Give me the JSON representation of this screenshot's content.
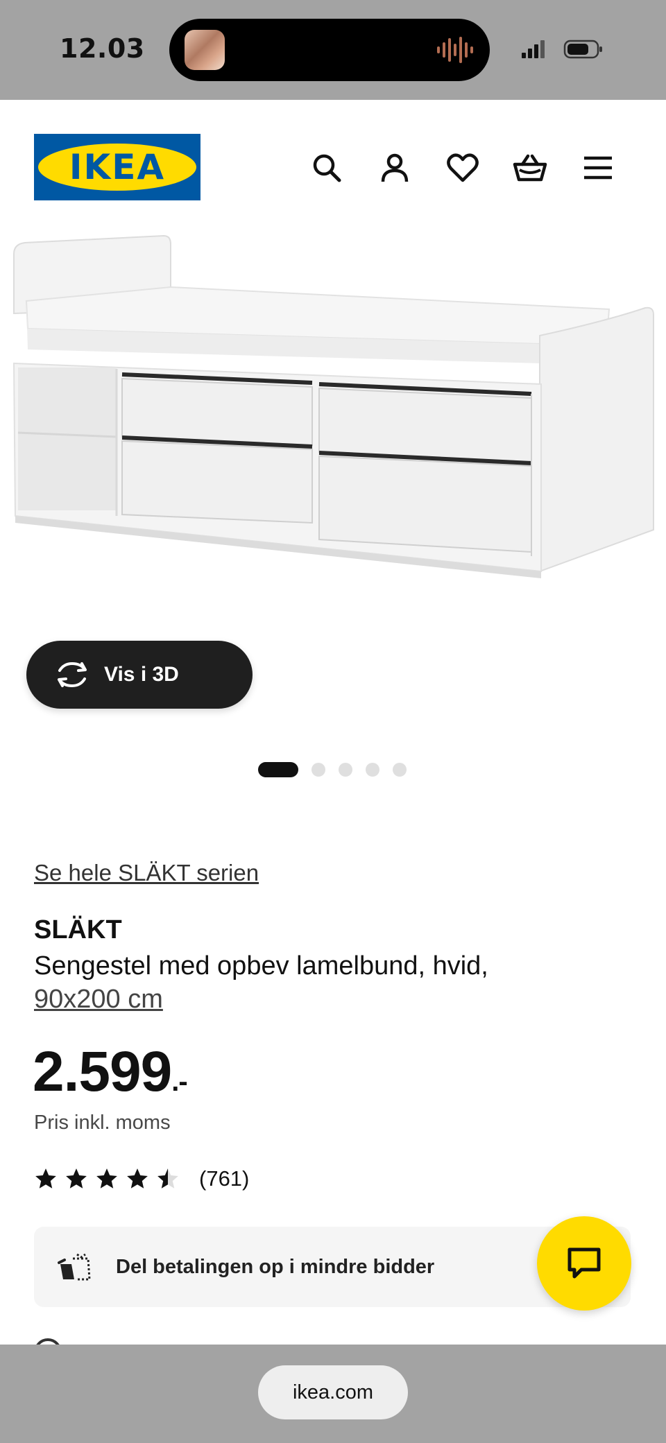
{
  "status_bar": {
    "time": "12.03"
  },
  "header": {
    "logo_text": "IKEA",
    "icons": [
      "search-icon",
      "account-icon",
      "heart-icon",
      "basket-icon",
      "menu-icon"
    ]
  },
  "gallery": {
    "view_3d_label": "Vis i 3D",
    "slide_count": 5,
    "active_slide": 1
  },
  "product": {
    "series_link": "Se hele SLÄKT serien",
    "name": "SLÄKT",
    "description": "Sengestel med opbev lamelbund, hvid,",
    "size": "90x200 cm",
    "price": "2.599",
    "price_suffix": ".-",
    "price_note": "Pris inkl. moms",
    "rating": 4.5,
    "rating_max": 5,
    "review_count": "(761)"
  },
  "installment": {
    "label": "Del betalingen op i mindre bidder"
  },
  "browser": {
    "url": "ikea.com"
  },
  "colors": {
    "ikea_blue": "#0058a3",
    "ikea_yellow": "#ffdb00",
    "system_gray": "#a3a3a3"
  }
}
